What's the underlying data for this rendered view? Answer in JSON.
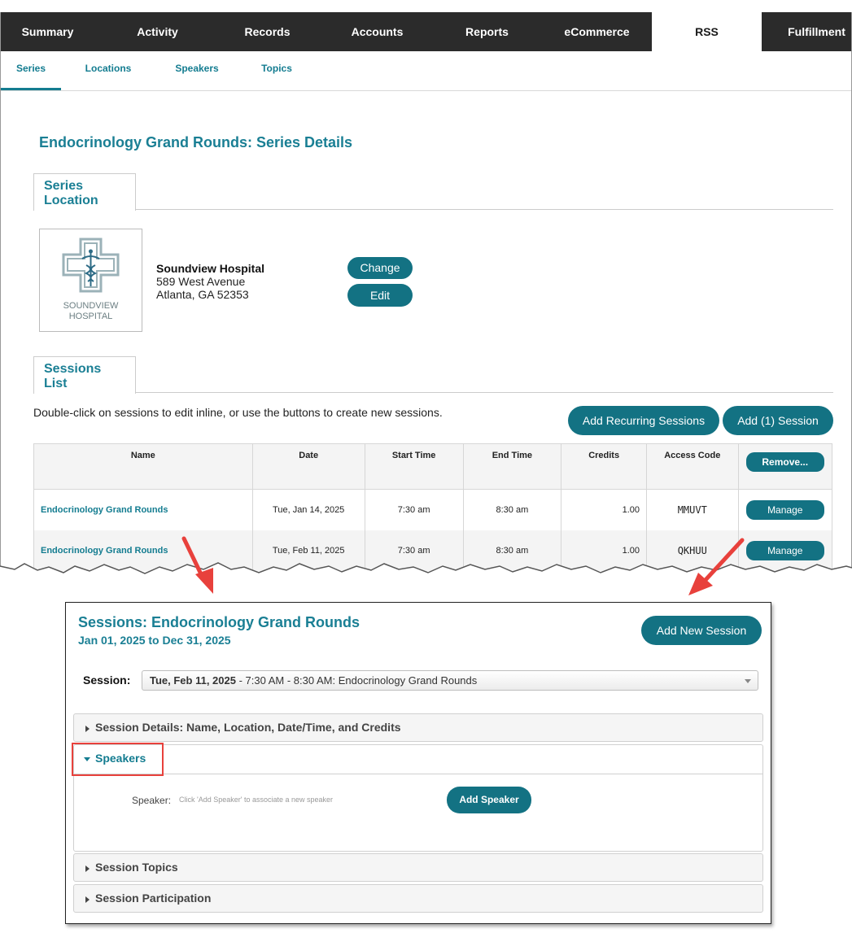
{
  "nav": {
    "tabs": [
      "Summary",
      "Activity",
      "Records",
      "Accounts",
      "Reports",
      "eCommerce",
      "RSS",
      "Fulfillment"
    ],
    "active_tab": "RSS"
  },
  "subnav": {
    "tabs": [
      "Series",
      "Locations",
      "Speakers",
      "Topics"
    ],
    "active_tab": "Series"
  },
  "page": {
    "title": "Endocrinology Grand Rounds: Series Details"
  },
  "series_location": {
    "tab_label": "Series Location",
    "logo_text": [
      "SOUNDVIEW",
      "HOSPITAL"
    ],
    "name": "Soundview Hospital",
    "address1": "589 West Avenue",
    "address2": "Atlanta, GA 52353",
    "change_button": "Change",
    "edit_button": "Edit"
  },
  "sessions_list": {
    "tab_label": "Sessions List",
    "instructions": "Double-click on sessions to edit inline, or use the buttons to create new sessions.",
    "add_recurring_button": "Add Recurring Sessions",
    "add_session_button": "Add (1) Session",
    "columns": [
      "Name",
      "Date",
      "Start Time",
      "End Time",
      "Credits",
      "Access Code"
    ],
    "remove_button": "Remove...",
    "manage_button": "Manage",
    "rows": [
      {
        "name": "Endocrinology Grand Rounds",
        "date": "Tue, Jan 14, 2025",
        "start": "7:30 am",
        "end": "8:30 am",
        "credits": "1.00",
        "code": "MMUVT"
      },
      {
        "name": "Endocrinology Grand Rounds",
        "date": "Tue, Feb 11, 2025",
        "start": "7:30 am",
        "end": "8:30 am",
        "credits": "1.00",
        "code": "QKHUU"
      }
    ]
  },
  "dialog": {
    "title": "Sessions: Endocrinology Grand Rounds",
    "date_range": "Jan 01, 2025 to Dec 31, 2025",
    "add_new_session_button": "Add New Session",
    "session_label": "Session:",
    "session_select_bold": "Tue, Feb 11, 2025",
    "session_select_rest": " - 7:30 AM - 8:30 AM: Endocrinology Grand Rounds",
    "sections": {
      "details": "Session Details: Name, Location, Date/Time, and Credits",
      "speakers": "Speakers",
      "topics": "Session Topics",
      "participation": "Session Participation"
    },
    "speaker_label": "Speaker:",
    "speaker_hint": "Click 'Add Speaker' to associate a new speaker",
    "add_speaker_button": "Add Speaker"
  },
  "colors": {
    "nav_bg": "#2b2b2b",
    "accent": "#1a7f94",
    "button": "#137283",
    "annotation_red": "#e8413c"
  }
}
